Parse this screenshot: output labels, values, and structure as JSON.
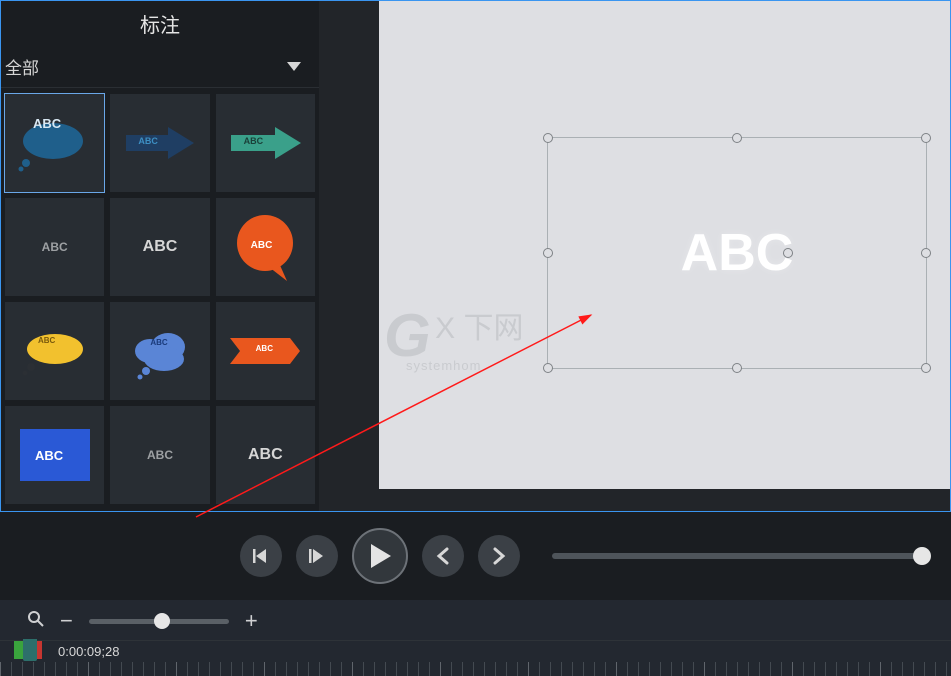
{
  "sidebar": {
    "title": "标注",
    "filter_label": "全部",
    "tiles": [
      {
        "label": "ABC",
        "shape": "oval-blue"
      },
      {
        "label": "ABC",
        "shape": "arrow-darkblue"
      },
      {
        "label": "ABC",
        "shape": "arrow-teal"
      },
      {
        "label": "ABC",
        "shape": "text-plain"
      },
      {
        "label": "ABC",
        "shape": "text-plain-lg"
      },
      {
        "label": "ABC",
        "shape": "speech-orange"
      },
      {
        "label": "ABC",
        "shape": "oval-yellow"
      },
      {
        "label": "ABC",
        "shape": "cloud-blue"
      },
      {
        "label": "ABC",
        "shape": "ribbon-orange"
      },
      {
        "label": "ABC",
        "shape": "rect-blue"
      },
      {
        "label": "ABC",
        "shape": "text-plain"
      },
      {
        "label": "ABC",
        "shape": "text-plain-lg"
      }
    ]
  },
  "canvas": {
    "selected_text": "ABC",
    "watermark_main": "G",
    "watermark_rest": "X 下网",
    "watermark_sub": "systemhom"
  },
  "controls": {
    "prev_frame": "prev-frame",
    "next_frame": "next-frame",
    "play": "play",
    "back": "back",
    "forward": "forward"
  },
  "timeline": {
    "timecode": "0:00:09;28"
  }
}
